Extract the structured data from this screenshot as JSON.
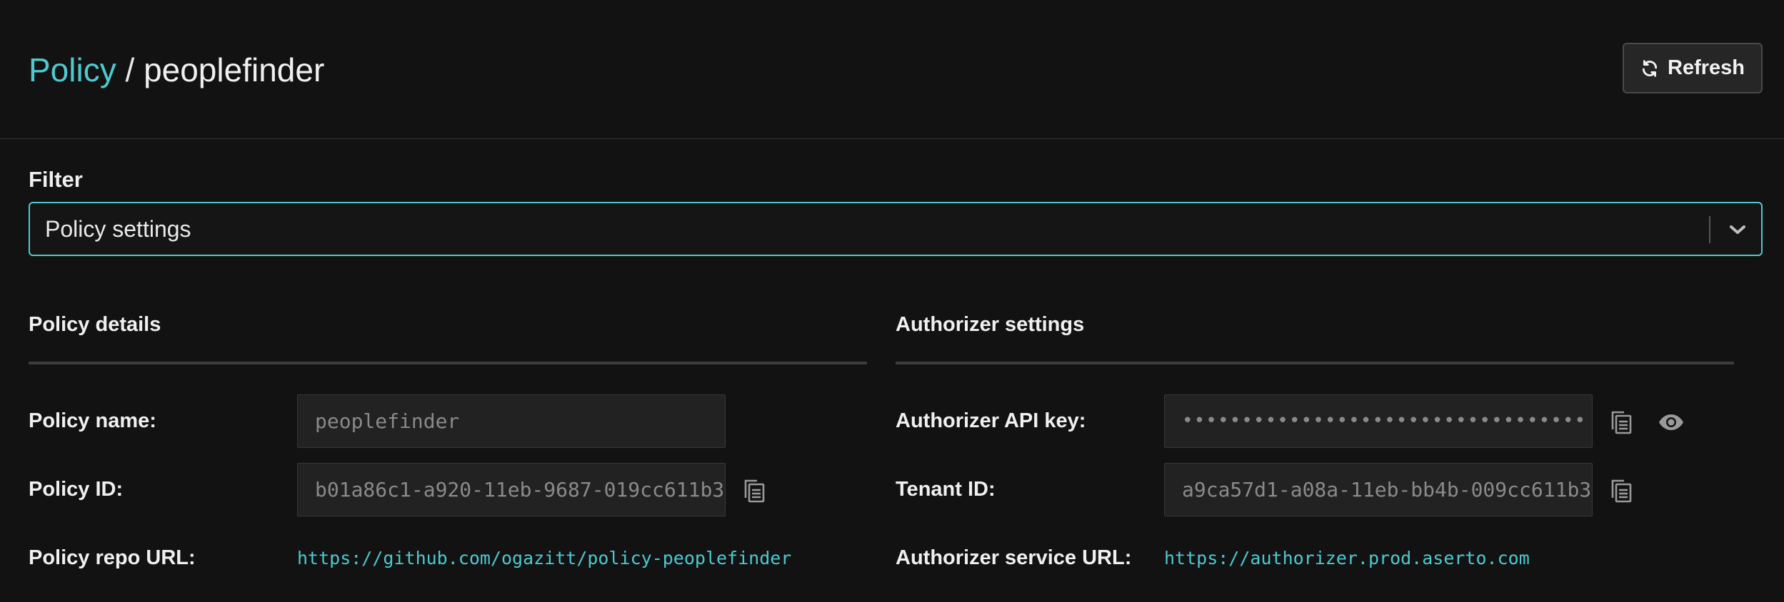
{
  "breadcrumb": {
    "root": "Policy",
    "separator": " / ",
    "current": "peoplefinder"
  },
  "toolbar": {
    "refresh_label": "Refresh",
    "refresh_icon": "refresh-icon"
  },
  "filter": {
    "label": "Filter",
    "selected": "Policy settings",
    "icon": "chevron-down-icon"
  },
  "policy_details": {
    "title": "Policy details",
    "name_label": "Policy name:",
    "name_value": "peoplefinder",
    "id_label": "Policy ID:",
    "id_value": "b01a86c1-a920-11eb-9687-019cc611b3",
    "repo_label": "Policy repo URL:",
    "repo_url": "https://github.com/ogazitt/policy-peoplefinder"
  },
  "authorizer_settings": {
    "title": "Authorizer settings",
    "api_key_label": "Authorizer API key:",
    "api_key_value": "••••••••••••••••••••••••••••••••••",
    "tenant_label": "Tenant ID:",
    "tenant_value": "a9ca57d1-a08a-11eb-bb4b-009cc611b3",
    "service_label": "Authorizer service URL:",
    "service_url": "https://authorizer.prod.aserto.com"
  },
  "colors": {
    "accent": "#4ec9cf",
    "background": "#121212",
    "input_bg": "#222222"
  }
}
